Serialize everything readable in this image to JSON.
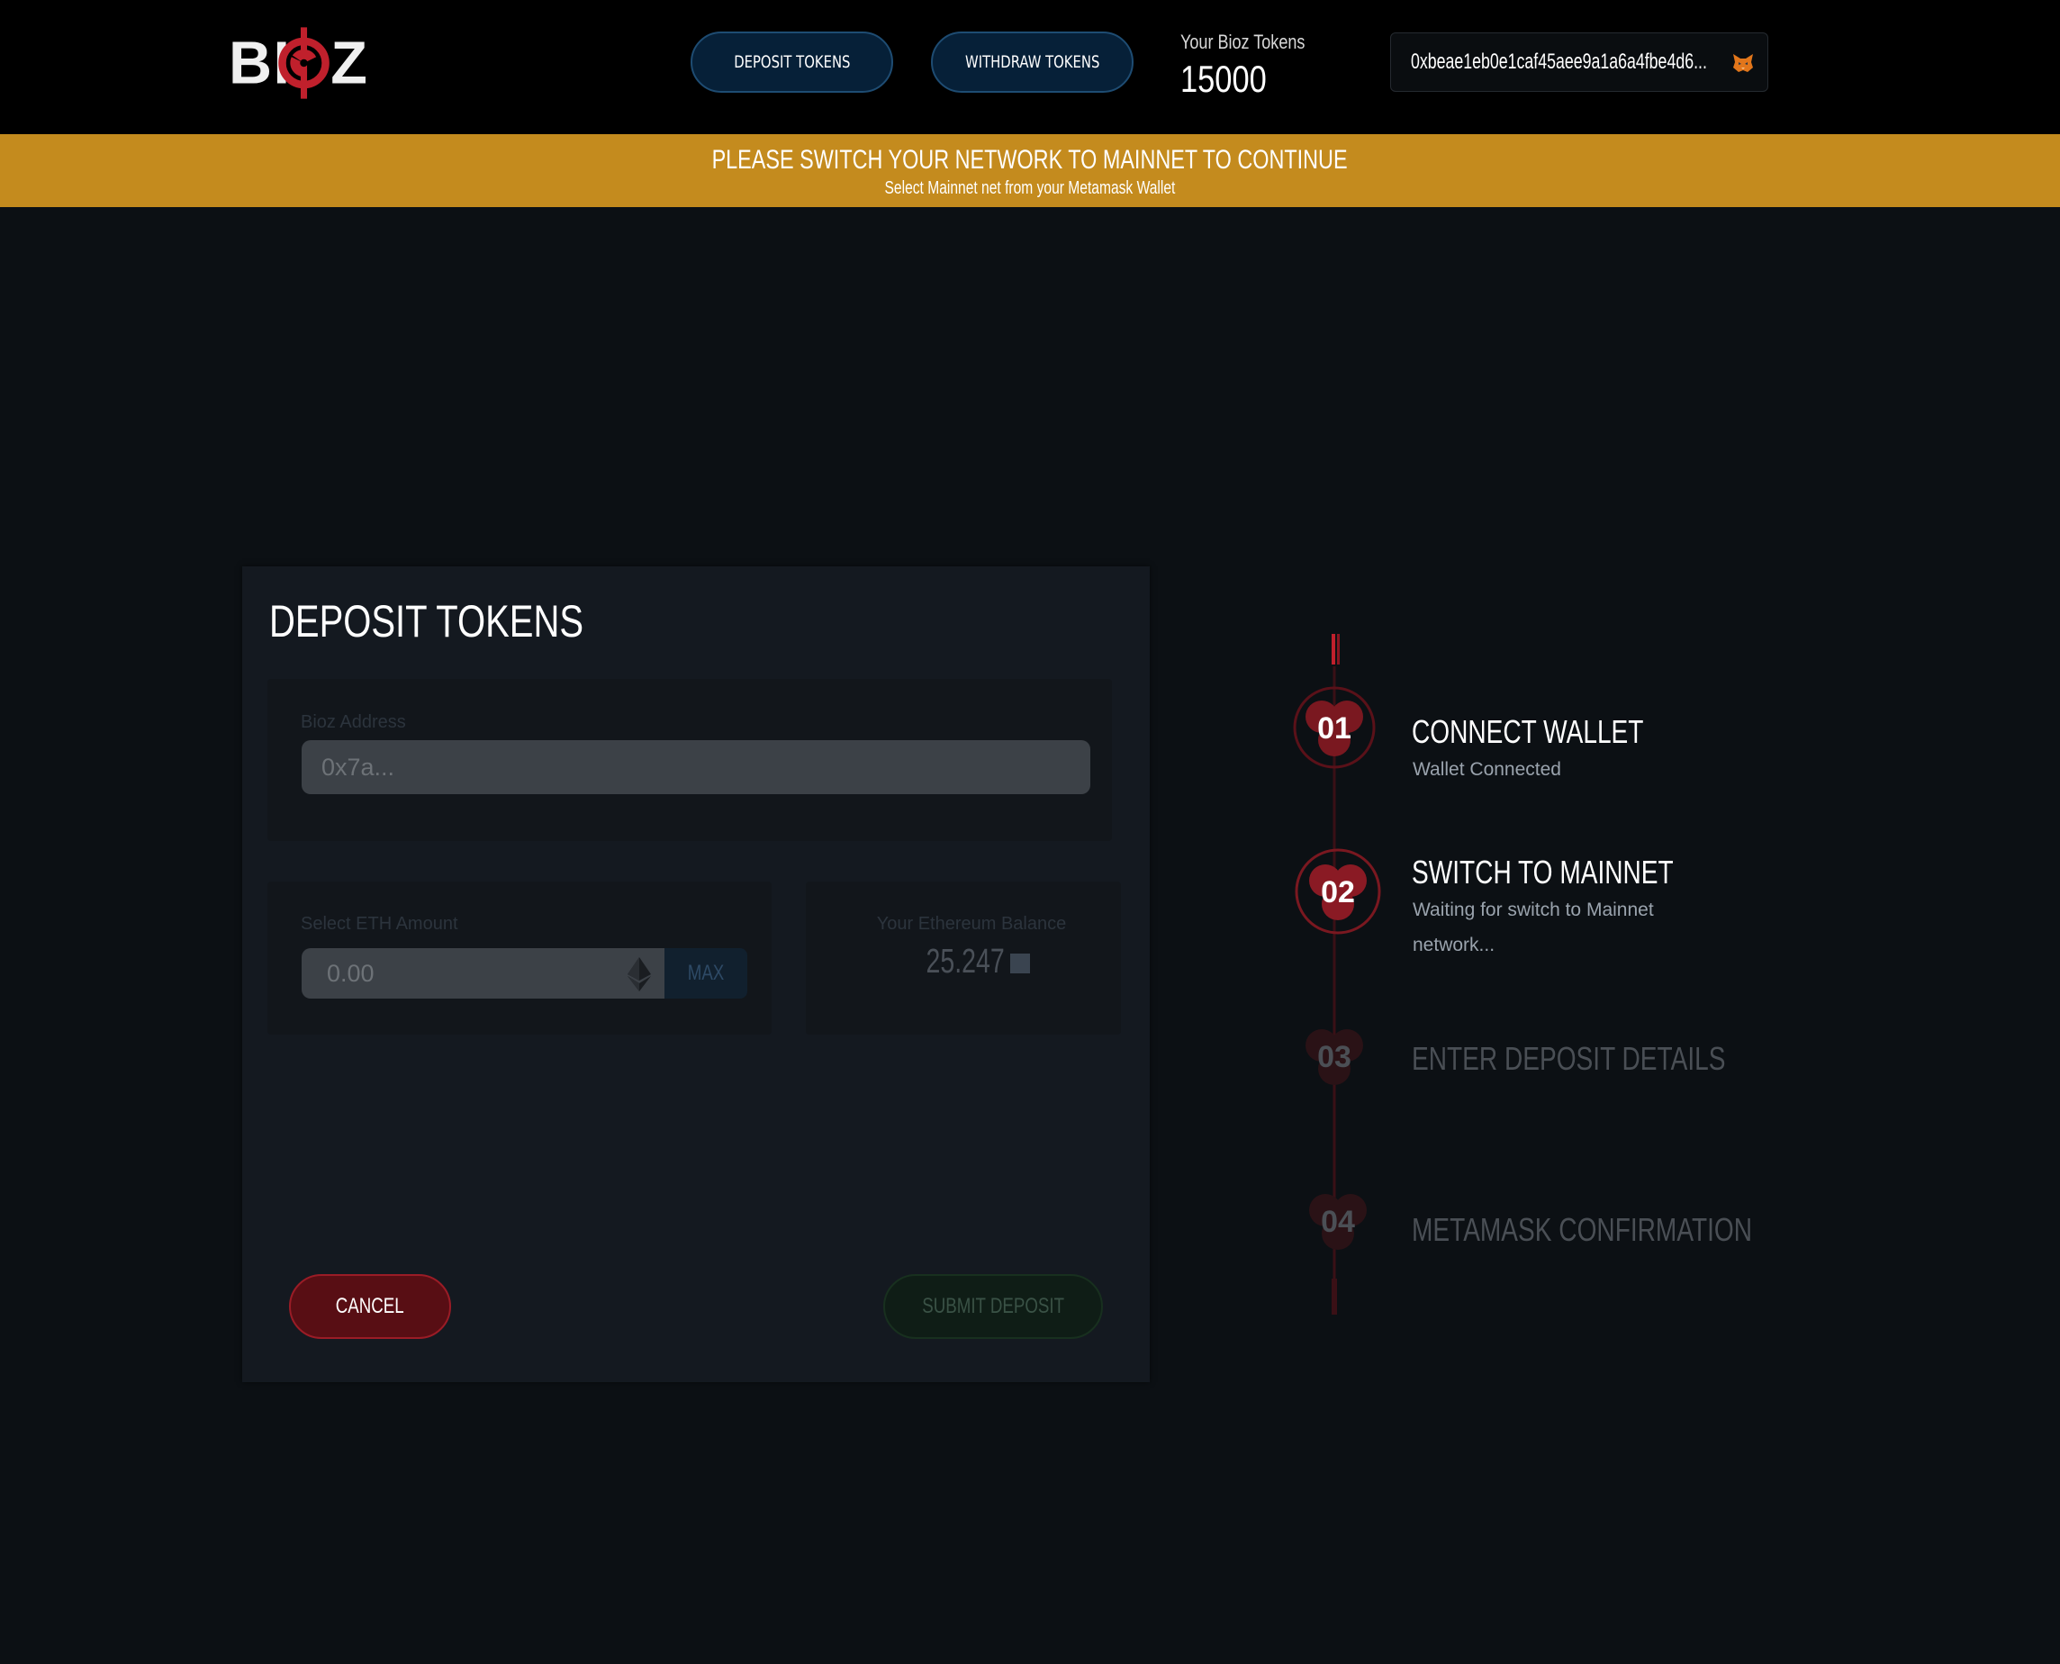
{
  "header": {
    "logo_text": "BIOZ",
    "nav": {
      "deposit_label": "DEPOSIT TOKENS",
      "withdraw_label": "WITHDRAW TOKENS"
    },
    "tokens": {
      "label": "Your Bioz Tokens",
      "value": "15000"
    },
    "wallet": {
      "address": "0xbeae1eb0e1caf45aee9a1a6a4fbe4d6...",
      "icon": "metamask-fox-icon"
    }
  },
  "banner": {
    "title": "PLEASE SWITCH YOUR NETWORK TO MAINNET TO CONTINUE",
    "subtitle": "Select Mainnet net from your Metamask Wallet",
    "color": "#c48b1e"
  },
  "deposit_card": {
    "title": "DEPOSIT TOKENS",
    "address_field": {
      "label": "Bioz Address",
      "placeholder": "0x7a..."
    },
    "eth_field": {
      "label": "Select ETH Amount",
      "placeholder": "0.00",
      "max_label": "MAX",
      "icon": "ethereum-icon"
    },
    "balance": {
      "label": "Your Ethereum Balance",
      "value": "25.247"
    },
    "cancel_label": "CANCEL",
    "submit_label": "SUBMIT DEPOSIT"
  },
  "steps": [
    {
      "number": "01",
      "title": "CONNECT WALLET",
      "subtitle": "Wallet Connected",
      "state": "done"
    },
    {
      "number": "02",
      "title": "SWITCH TO MAINNET",
      "subtitle": "Waiting for switch to Mainnet network...",
      "state": "active"
    },
    {
      "number": "03",
      "title": "ENTER DEPOSIT DETAILS",
      "subtitle": "",
      "state": "pending"
    },
    {
      "number": "04",
      "title": "METAMASK CONFIRMATION",
      "subtitle": "",
      "state": "pending"
    }
  ],
  "colors": {
    "accent_red": "#c0202c",
    "nav_button_bg": "#062038",
    "background": "#0c1014"
  }
}
